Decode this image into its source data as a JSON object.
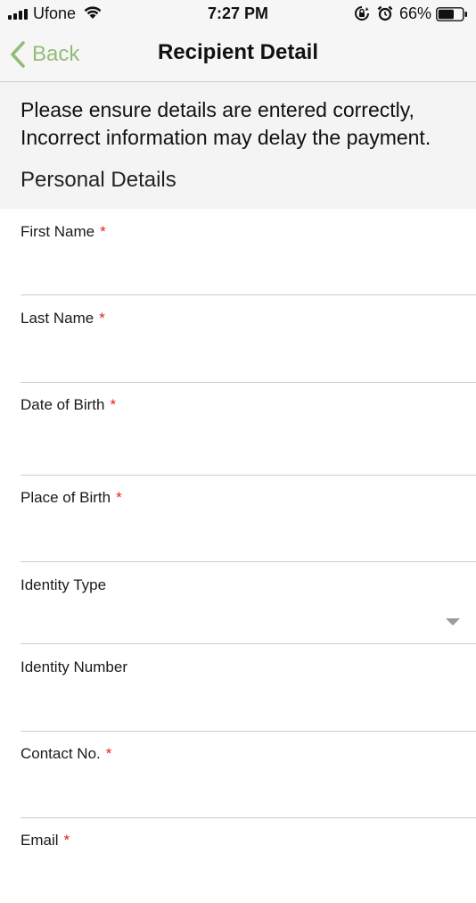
{
  "status_bar": {
    "carrier": "Ufone",
    "time": "7:27 PM",
    "battery_percent": "66%",
    "battery_level": 0.66,
    "icons": [
      "signal-icon",
      "wifi-icon",
      "rotation-lock-icon",
      "alarm-icon",
      "battery-icon"
    ]
  },
  "nav": {
    "back_label": "Back",
    "title": "Recipient Detail",
    "accent_color": "#94bc78"
  },
  "notice": {
    "text": "Please ensure details are entered correctly, Incorrect information may delay the payment.",
    "section_title": "Personal Details"
  },
  "form": {
    "required_marker": "*",
    "fields": [
      {
        "label": "First Name",
        "required": true,
        "value": "",
        "type": "text"
      },
      {
        "label": "Last Name",
        "required": true,
        "value": "",
        "type": "text"
      },
      {
        "label": "Date of Birth",
        "required": true,
        "value": "",
        "type": "text"
      },
      {
        "label": "Place of Birth",
        "required": true,
        "value": "",
        "type": "text"
      },
      {
        "label": "Identity Type",
        "required": false,
        "value": "",
        "type": "select"
      },
      {
        "label": "Identity Number",
        "required": false,
        "value": "",
        "type": "text"
      },
      {
        "label": "Contact No.",
        "required": true,
        "value": "",
        "type": "text"
      },
      {
        "label": "Email",
        "required": true,
        "value": "",
        "type": "text"
      }
    ]
  }
}
